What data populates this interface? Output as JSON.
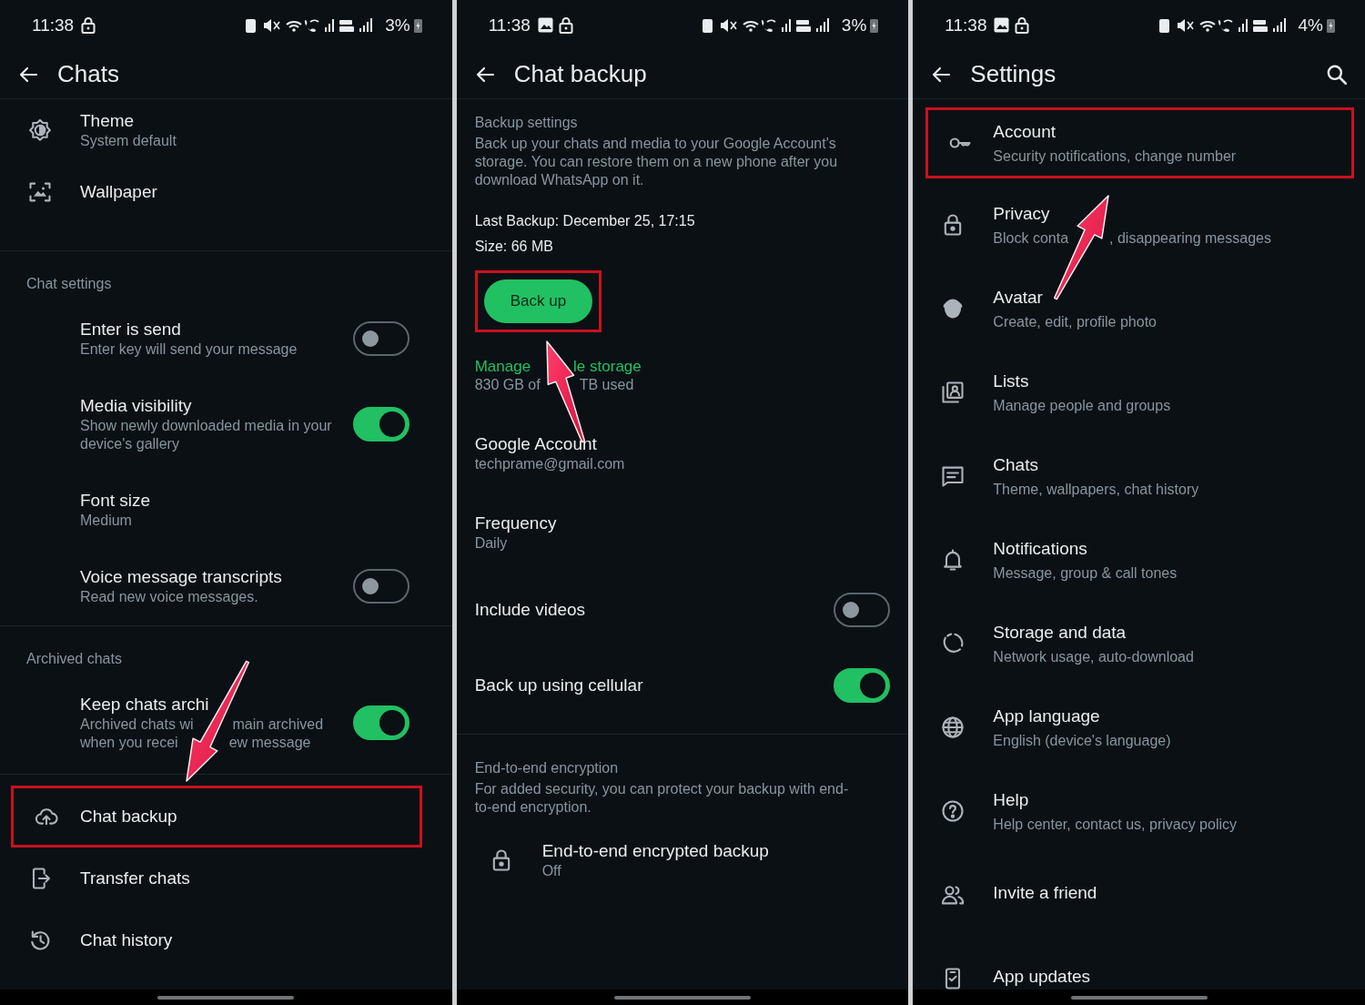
{
  "panels": [
    {
      "status": {
        "time": "11:38",
        "notification_icon": false,
        "battery": "3%"
      },
      "title": "Chats",
      "search": false,
      "sections": [
        {
          "items": [
            {
              "kind": "nav",
              "title": "Theme",
              "subtitle": "System default"
            },
            {
              "kind": "nav",
              "title": "Wallpaper"
            }
          ]
        },
        {
          "header": "Chat settings",
          "items": [
            {
              "kind": "toggle",
              "title": "Enter is send",
              "subtitle": "Enter key will send your message",
              "on": false
            },
            {
              "kind": "toggle",
              "title": "Media visibility",
              "subtitle": "Show newly downloaded media in your device's gallery",
              "on": true
            },
            {
              "kind": "plain",
              "title": "Font size",
              "subtitle": "Medium"
            },
            {
              "kind": "toggle",
              "title": "Voice message transcripts",
              "subtitle": "Read new voice messages.",
              "on": false
            }
          ]
        },
        {
          "header": "Archived chats",
          "items": [
            {
              "kind": "toggle",
              "title": "Keep chats archi",
              "subtitle_lines": [
                [
                  "Archived chats wi",
                  "main archived"
                ],
                [
                  "when you recei",
                  "ew message"
                ]
              ],
              "on": true
            }
          ]
        },
        {
          "items": [
            {
              "kind": "nav",
              "title": "Chat backup",
              "highlighted": true
            },
            {
              "kind": "nav",
              "title": "Transfer chats",
              "highlighted": false
            },
            {
              "kind": "nav",
              "title": "Chat history",
              "highlighted": false
            }
          ]
        }
      ]
    },
    {
      "status": {
        "time": "11:38",
        "notification_icon": true,
        "battery": "3%"
      },
      "title": "Chat backup",
      "search": false,
      "sections": [
        {
          "header": "Backup settings",
          "description": "Back up your chats and media to your Google Account's storage. You can restore them on a new phone after you download WhatsApp on it.",
          "items": [
            {
              "kind": "info",
              "title": "Last Backup: December 25, 17:15"
            },
            {
              "kind": "info",
              "title": "Size: 66 MB"
            },
            {
              "kind": "button",
              "title": "Back up",
              "highlighted": true
            },
            {
              "kind": "link",
              "title_parts": [
                "Manage",
                "le storage"
              ],
              "subtitle_parts": [
                "830 GB of",
                "TB used"
              ]
            },
            {
              "kind": "detail",
              "title": "Google Account",
              "subtitle": "techprame@gmail.com"
            },
            {
              "kind": "detail",
              "title": "Frequency",
              "subtitle": "Daily"
            },
            {
              "kind": "toggle",
              "title": "Include videos",
              "on": false
            },
            {
              "kind": "toggle",
              "title": "Back up using cellular",
              "on": true
            }
          ]
        },
        {
          "header": "End-to-end encryption",
          "description": "For added security, you can protect your backup with end-to-end encryption.",
          "items": [
            {
              "kind": "nav",
              "title": "End-to-end encrypted backup",
              "subtitle": "Off"
            }
          ]
        }
      ]
    },
    {
      "status": {
        "time": "11:38",
        "notification_icon": true,
        "battery": "4%"
      },
      "title": "Settings",
      "search": true,
      "sections": [
        {
          "items": [
            {
              "kind": "nav",
              "title": "Account",
              "subtitle": "Security notifications, change number",
              "highlighted": true
            },
            {
              "kind": "nav",
              "title": "Privacy",
              "subtitle_parts": [
                "Block conta",
                ", disappearing messages"
              ],
              "highlighted": false
            },
            {
              "kind": "nav",
              "title": "Avatar",
              "subtitle": "Create, edit, profile photo",
              "highlighted": false
            },
            {
              "kind": "nav",
              "title": "Lists",
              "subtitle": "Manage people and groups",
              "highlighted": false
            },
            {
              "kind": "nav",
              "title": "Chats",
              "subtitle": "Theme, wallpapers, chat history",
              "highlighted": false
            },
            {
              "kind": "nav",
              "title": "Notifications",
              "subtitle": "Message, group & call tones",
              "highlighted": false
            },
            {
              "kind": "nav",
              "title": "Storage and data",
              "subtitle": "Network usage, auto-download",
              "highlighted": false
            },
            {
              "kind": "nav",
              "title": "App language",
              "subtitle": "English (device's language)",
              "highlighted": false
            },
            {
              "kind": "nav",
              "title": "Help",
              "subtitle": "Help center, contact us, privacy policy",
              "highlighted": false
            },
            {
              "kind": "nav",
              "title": "Invite a friend",
              "highlighted": false
            },
            {
              "kind": "nav",
              "title": "App updates",
              "highlighted": false
            }
          ]
        }
      ]
    }
  ]
}
